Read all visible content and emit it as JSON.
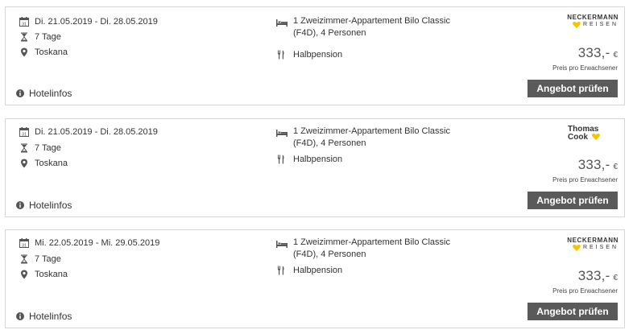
{
  "offers": [
    {
      "dates": "Di. 21.05.2019 - Di. 28.05.2019",
      "duration": "7 Tage",
      "location": "Toskana",
      "room_line1": "1 Zweizimmer-Appartement Bilo Classic",
      "room_line2": "(F4D), 4 Personen",
      "board": "Halbpension",
      "hotel_info": "Hotelinfos",
      "price": "333,-",
      "currency": "€",
      "price_note": "Preis pro Erwachsener",
      "cta": "Angebot prüfen",
      "brand_line1": "NECKERMANN",
      "brand_line2": "REISEN"
    },
    {
      "dates": "Di. 21.05.2019 - Di. 28.05.2019",
      "duration": "7 Tage",
      "location": "Toskana",
      "room_line1": "1 Zweizimmer-Appartement Bilo Classic",
      "room_line2": "(F4D), 4 Personen",
      "board": "Halbpension",
      "hotel_info": "Hotelinfos",
      "price": "333,-",
      "currency": "€",
      "price_note": "Preis pro Erwachsener",
      "cta": "Angebot prüfen",
      "brand_line1": "Thomas",
      "brand_line2": "Cook"
    },
    {
      "dates": "Mi. 22.05.2019 - Mi. 29.05.2019",
      "duration": "7 Tage",
      "location": "Toskana",
      "room_line1": "1 Zweizimmer-Appartement Bilo Classic",
      "room_line2": "(F4D), 4 Personen",
      "board": "Halbpension",
      "hotel_info": "Hotelinfos",
      "price": "333,-",
      "currency": "€",
      "price_note": "Preis pro Erwachsener",
      "cta": "Angebot prüfen",
      "brand_line1": "NECKERMANN",
      "brand_line2": "REISEN"
    }
  ],
  "colors": {
    "button_bg": "#5a5a5a",
    "brand_heart": "#f5c400",
    "border": "#d7d7d7"
  },
  "icons": [
    "calendar-icon",
    "hourglass-icon",
    "location-pin-icon",
    "bed-icon",
    "cutlery-icon",
    "info-icon",
    "heart-icon"
  ]
}
